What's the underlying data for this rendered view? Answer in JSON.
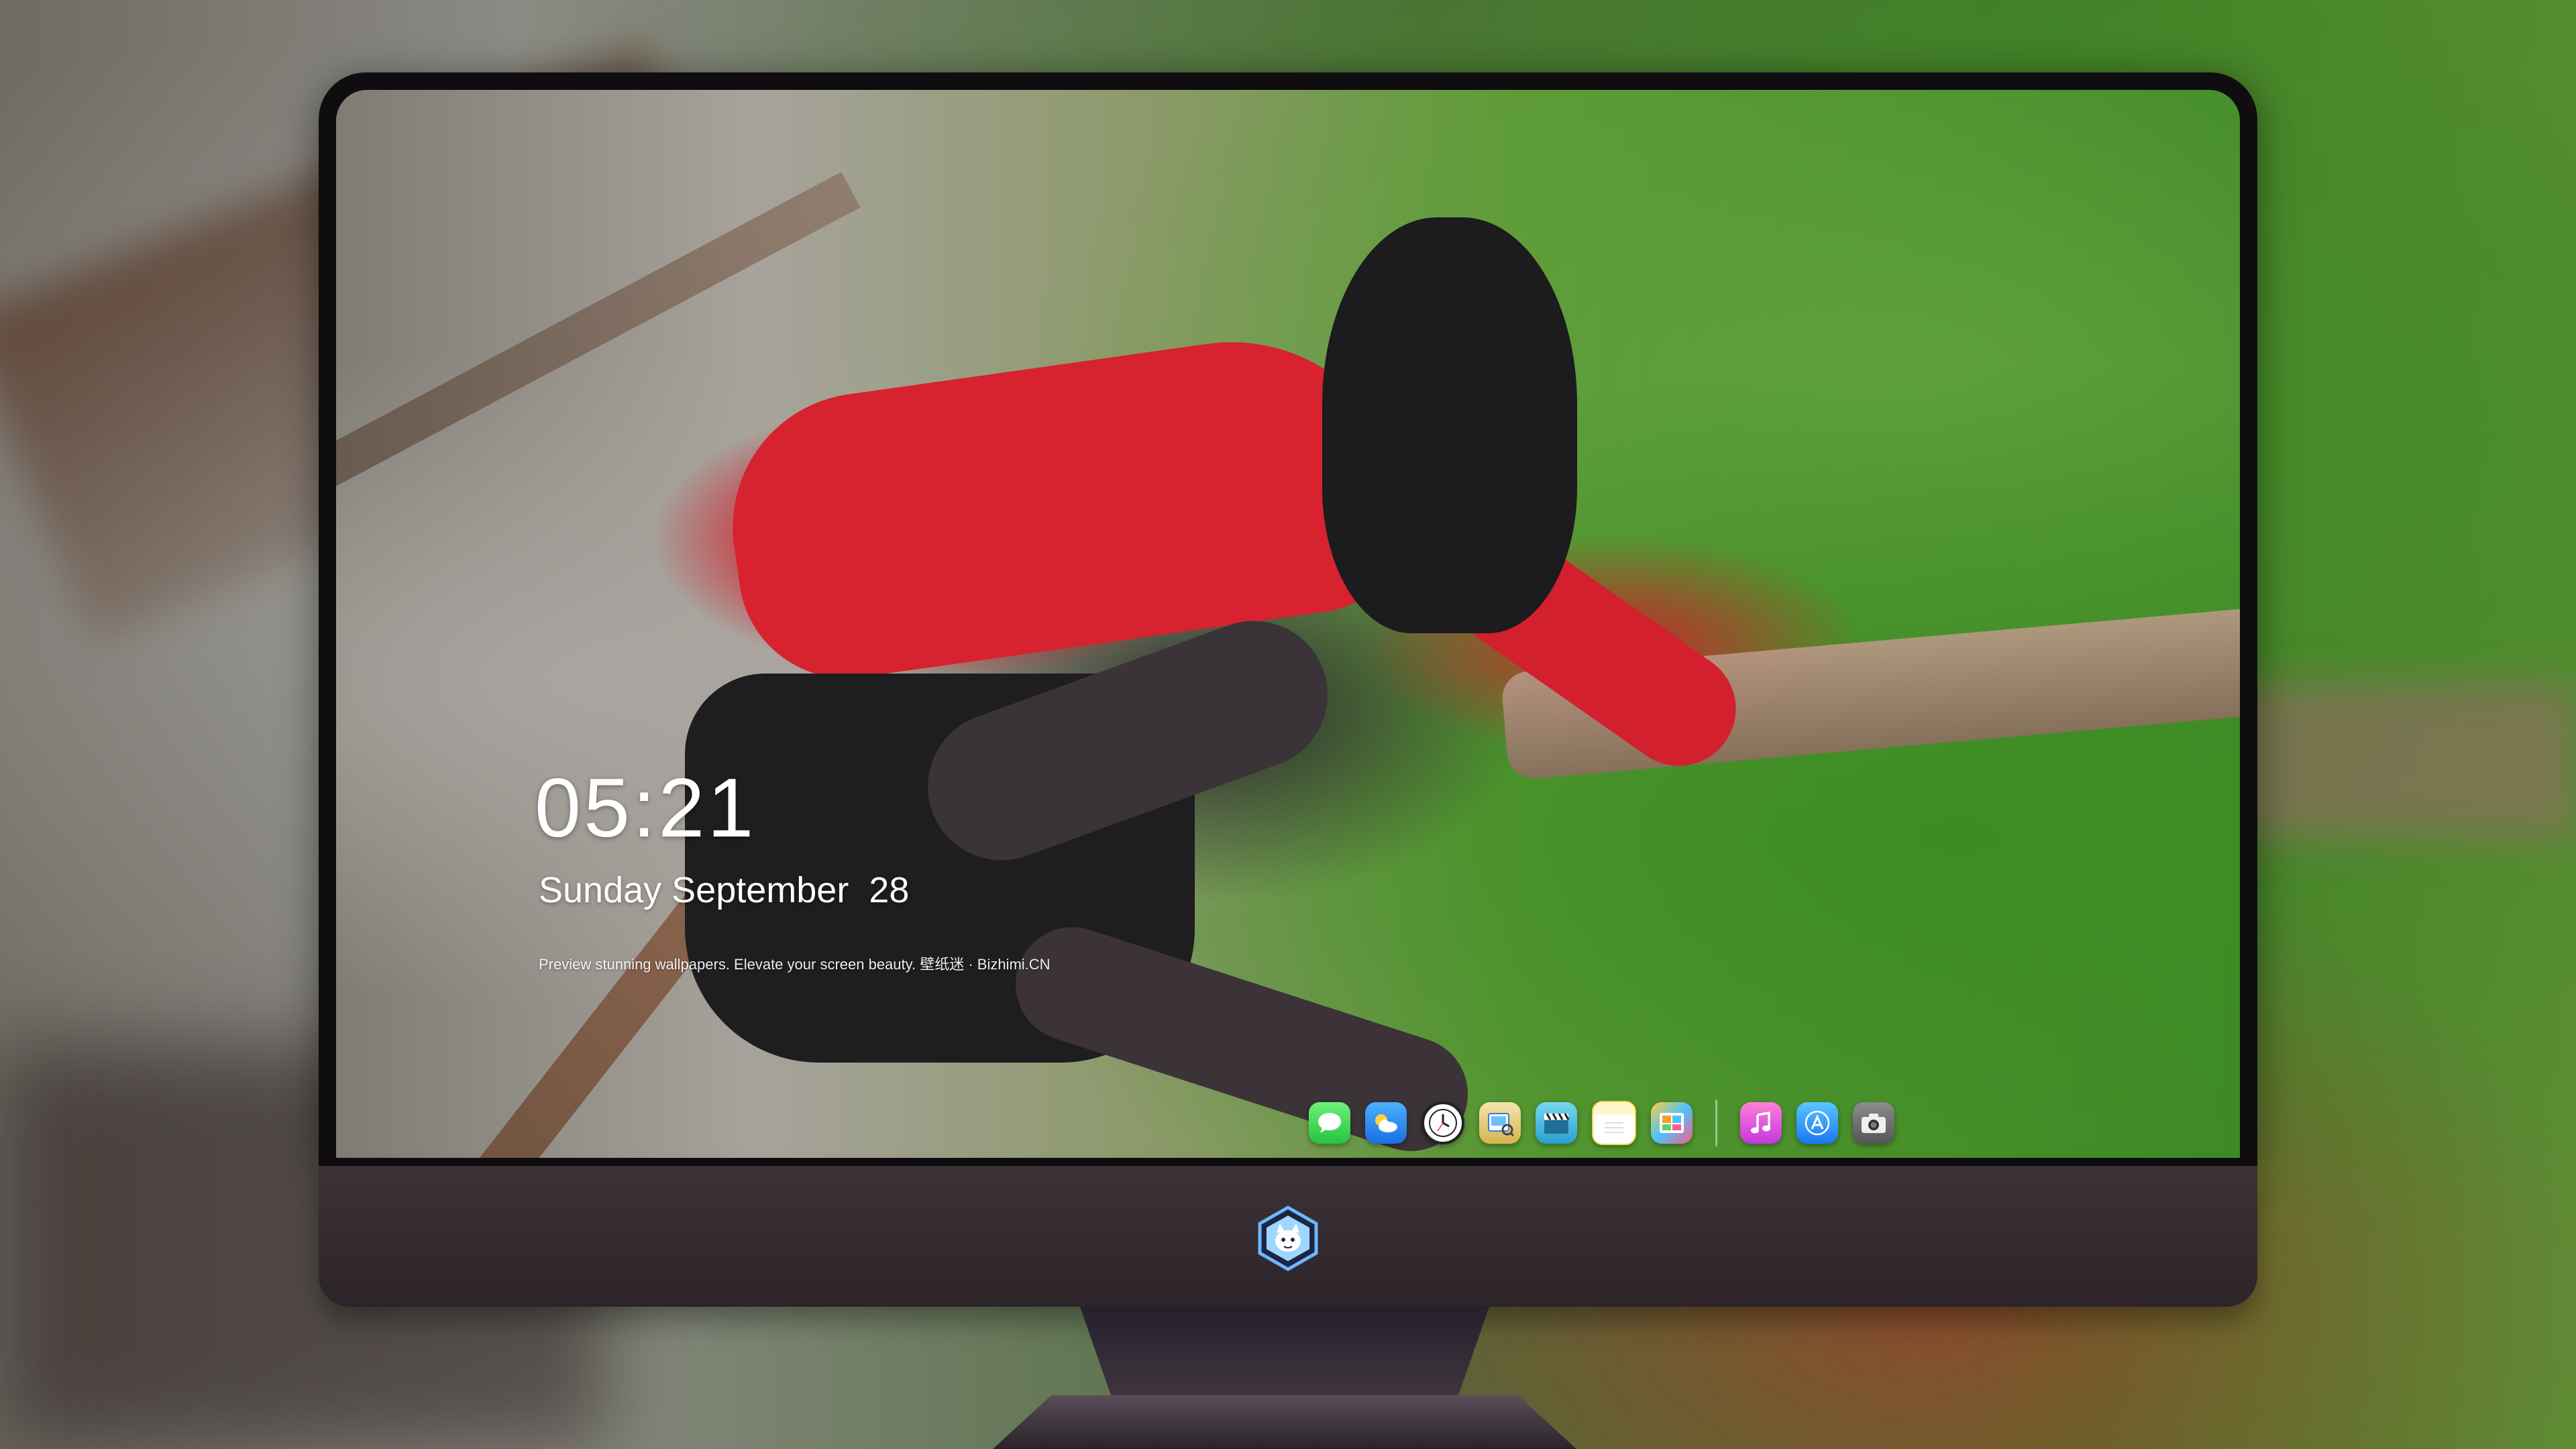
{
  "lock_screen": {
    "time": "05:21",
    "date": "Sunday September  28",
    "tagline": "Preview stunning wallpapers. Elevate your screen beauty. 壁纸迷 · Bizhimi.CN"
  },
  "dock": {
    "apps": [
      {
        "name": "Messages",
        "icon": "messages-icon"
      },
      {
        "name": "Weather",
        "icon": "weather-icon"
      },
      {
        "name": "Clock",
        "icon": "clock-icon"
      },
      {
        "name": "Preview",
        "icon": "preview-icon"
      },
      {
        "name": "Clips",
        "icon": "clapperboard-icon"
      },
      {
        "name": "Notes",
        "icon": "notes-icon"
      },
      {
        "name": "Photos",
        "icon": "photos-icon"
      },
      {
        "name": "Music",
        "icon": "music-icon"
      },
      {
        "name": "App Store",
        "icon": "app-store-icon"
      },
      {
        "name": "Camera",
        "icon": "camera-icon"
      }
    ]
  },
  "monitor": {
    "logo": "bizhimi-logo-icon"
  },
  "colors": {
    "bezel": "#0f0d0f",
    "chin": "#3c3237",
    "text": "#ffffff"
  }
}
